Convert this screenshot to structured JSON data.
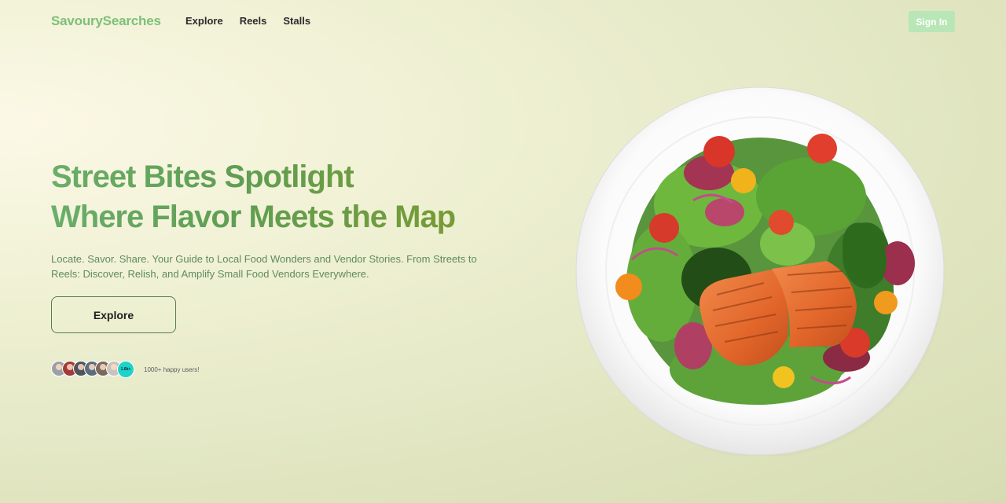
{
  "nav": {
    "brand": "SavourySearches",
    "links": [
      "Explore",
      "Reels",
      "Stalls"
    ],
    "signin_label": "Sign In"
  },
  "hero": {
    "title_line1": "Street Bites Spotlight",
    "title_line2": "Where Flavor Meets the Map",
    "subtitle": "Locate. Savor. Share. Your Guide to Local Food Wonders and Vendor Stories. From Streets to Reels: Discover, Relish, and Amplify Small Food Vendors Everywhere.",
    "explore_label": "Explore"
  },
  "users": {
    "count_badge": "1.6k+",
    "caption": "1000+ happy users!"
  },
  "colors": {
    "brand": "#7cc07a",
    "signin_bg": "#b9e6b6",
    "title_start": "#6aae6a",
    "title_end": "#7f9a2c",
    "count_badge": "#1ed3c8"
  },
  "image": {
    "icon": "salmon-salad-plate-image"
  }
}
